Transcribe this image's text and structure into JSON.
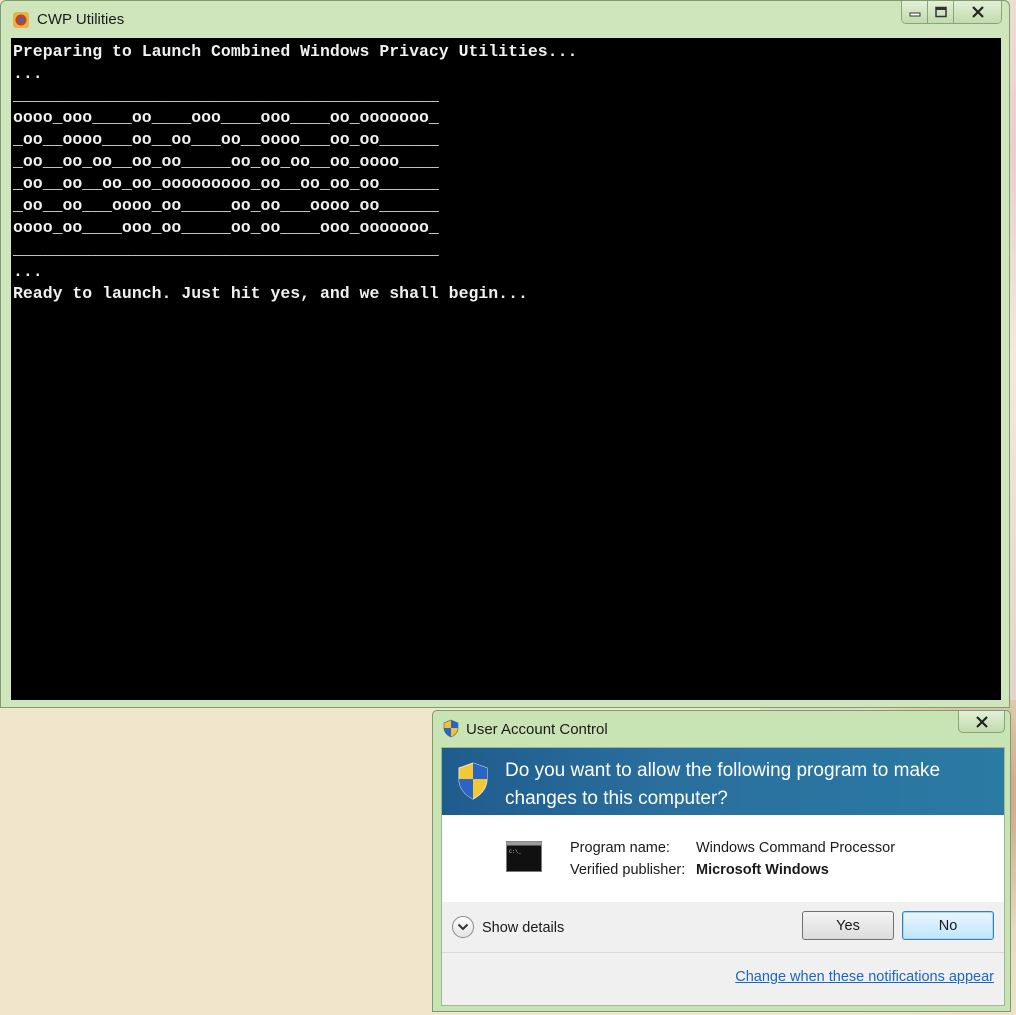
{
  "console_window": {
    "title": "CWP Utilities",
    "icon": "cwp-app-icon",
    "caption_buttons": [
      "minimize-icon",
      "maximize-icon",
      "close-icon"
    ],
    "output": "Preparing to Launch Combined Windows Privacy Utilities...\n...\n___________________________________________\noooo_ooo____oo____ooo____ooo____oo_ooooooo_\n_oo__oooo___oo__oo___oo__oooo___oo_oo______\n_oo__oo_oo__oo_oo_____oo_oo_oo__oo_oooo____\n_oo__oo__oo_oo_ooooooooo_oo__oo_oo_oo______\n_oo__oo___oooo_oo_____oo_oo___oooo_oo______\noooo_oo____ooo_oo_____oo_oo____ooo_ooooooo_\n___________________________________________\n...\nReady to launch. Just hit yes, and we shall begin...",
    "colors": {
      "frame": "#cfe6bd",
      "console_bg": "#000000",
      "console_text": "#f0f0f0"
    }
  },
  "uac_dialog": {
    "title": "User Account Control",
    "question": "Do you want to allow the following program to make changes to this computer?",
    "program_name_label": "Program name:",
    "program_name_value": "Windows Command Processor",
    "publisher_label": "Verified publisher:",
    "publisher_value": "Microsoft Windows",
    "show_details_label": "Show details",
    "yes_label": "Yes",
    "no_label": "No",
    "change_link": "Change when these notifications appear",
    "colors": {
      "header": "#1f5c8e",
      "link": "#1a66c2"
    }
  }
}
